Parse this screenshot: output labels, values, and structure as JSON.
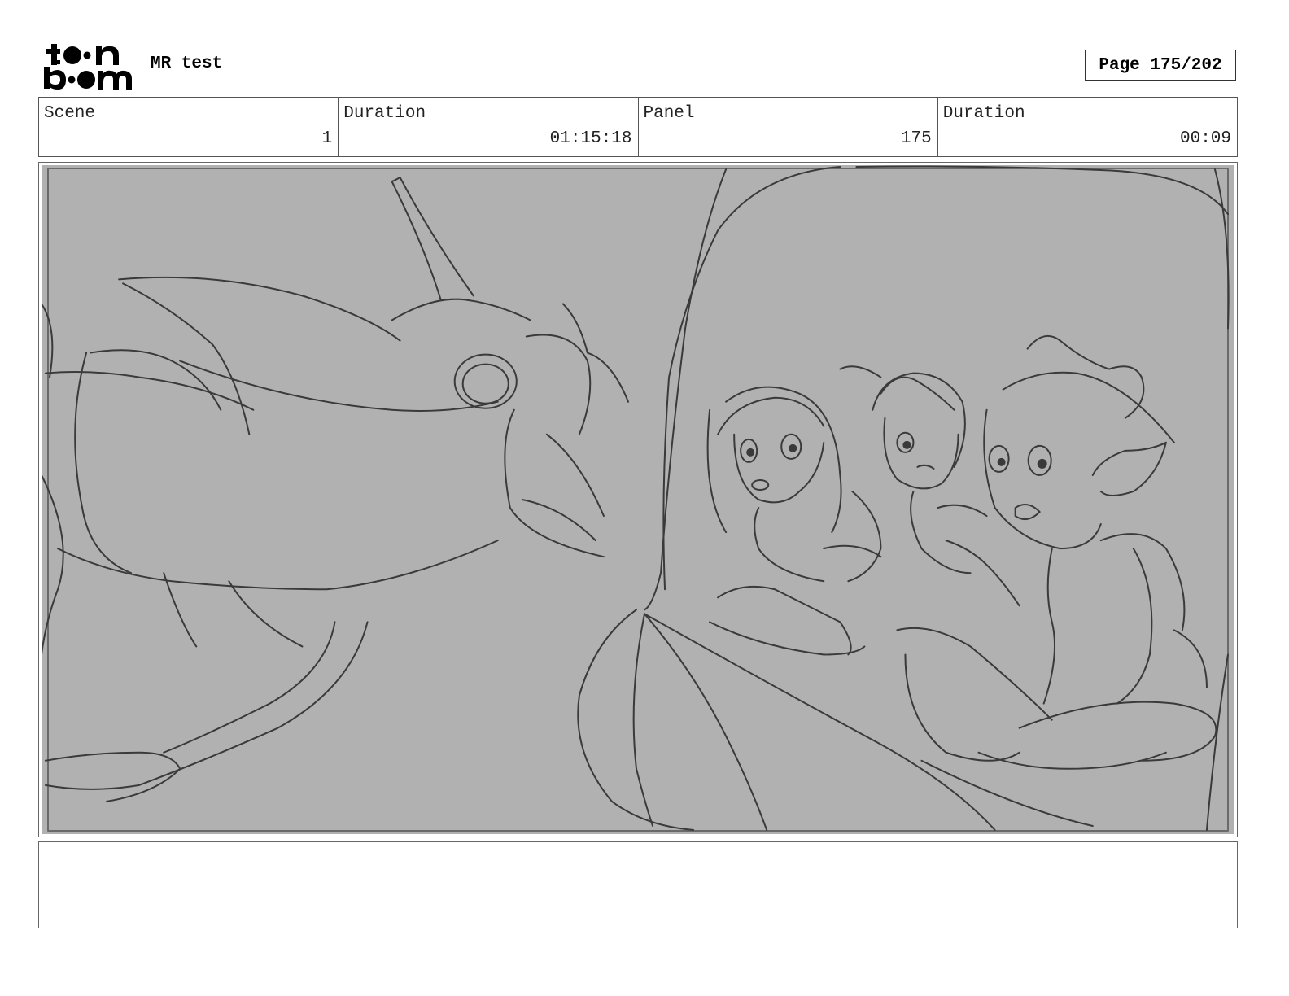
{
  "header": {
    "logo_text": "toon boom",
    "project_title": "MR test",
    "page_label": "Page 175/202"
  },
  "info": {
    "scene_label": "Scene",
    "scene_value": "1",
    "scene_duration_label": "Duration",
    "scene_duration_value": "01:15:18",
    "panel_label": "Panel",
    "panel_value": "175",
    "panel_duration_label": "Duration",
    "panel_duration_value": "00:09"
  },
  "colors": {
    "panel_background": "#b1b1b1",
    "sketch_line": "#3a3a3a"
  },
  "notes": {
    "text": ""
  }
}
